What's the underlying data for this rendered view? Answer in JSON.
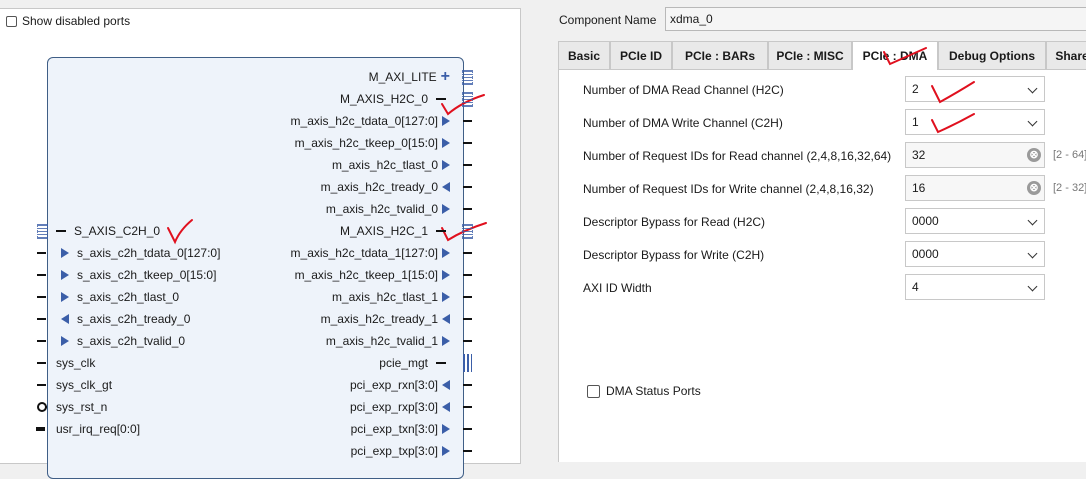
{
  "left": {
    "show_disabled_ports_label": "Show disabled ports",
    "right_pins": [
      {
        "label": "M_AXI_LITE",
        "kind": "plus"
      },
      {
        "label": "M_AXIS_H2C_0",
        "kind": "dash"
      },
      {
        "label": "m_axis_h2c_tdata_0[127:0]",
        "kind": "out"
      },
      {
        "label": "m_axis_h2c_tkeep_0[15:0]",
        "kind": "out"
      },
      {
        "label": "m_axis_h2c_tlast_0",
        "kind": "out"
      },
      {
        "label": "m_axis_h2c_tready_0",
        "kind": "in"
      },
      {
        "label": "m_axis_h2c_tvalid_0",
        "kind": "out"
      },
      {
        "label": "M_AXIS_H2C_1",
        "kind": "dash"
      },
      {
        "label": "m_axis_h2c_tdata_1[127:0]",
        "kind": "out"
      },
      {
        "label": "m_axis_h2c_tkeep_1[15:0]",
        "kind": "out"
      },
      {
        "label": "m_axis_h2c_tlast_1",
        "kind": "out"
      },
      {
        "label": "m_axis_h2c_tready_1",
        "kind": "in"
      },
      {
        "label": "m_axis_h2c_tvalid_1",
        "kind": "out"
      },
      {
        "label": "pcie_mgt",
        "kind": "dash"
      },
      {
        "label": "pci_exp_rxn[3:0]",
        "kind": "in"
      },
      {
        "label": "pci_exp_rxp[3:0]",
        "kind": "in"
      },
      {
        "label": "pci_exp_txn[3:0]",
        "kind": "out"
      },
      {
        "label": "pci_exp_txp[3:0]",
        "kind": "out"
      }
    ],
    "left_pins": [
      {
        "label": "S_AXIS_C2H_0",
        "kind": "bus"
      },
      {
        "label": "s_axis_c2h_tdata_0[127:0]",
        "kind": "in"
      },
      {
        "label": "s_axis_c2h_tkeep_0[15:0]",
        "kind": "in"
      },
      {
        "label": "s_axis_c2h_tlast_0",
        "kind": "in"
      },
      {
        "label": "s_axis_c2h_tready_0",
        "kind": "out"
      },
      {
        "label": "s_axis_c2h_tvalid_0",
        "kind": "in"
      },
      {
        "label": "sys_clk",
        "kind": "plain"
      },
      {
        "label": "sys_clk_gt",
        "kind": "plain"
      },
      {
        "label": "sys_rst_n",
        "kind": "bubble"
      },
      {
        "label": "usr_irq_req[0:0]",
        "kind": "bus-line"
      }
    ]
  },
  "right": {
    "component_name_label": "Component Name",
    "component_name_value": "xdma_0",
    "tabs": [
      {
        "label": "Basic",
        "active": false
      },
      {
        "label": "PCIe ID",
        "active": false
      },
      {
        "label": "PCIe : BARs",
        "active": false
      },
      {
        "label": "PCIe : MISC",
        "active": false
      },
      {
        "label": "PCIe : DMA",
        "active": true
      },
      {
        "label": "Debug Options",
        "active": false
      },
      {
        "label": "Share",
        "active": false
      }
    ],
    "fields": [
      {
        "label": "Number of DMA Read Channel (H2C)",
        "value": "2",
        "control": "select",
        "range": ""
      },
      {
        "label": "Number of DMA Write Channel (C2H)",
        "value": "1",
        "control": "select",
        "range": ""
      },
      {
        "label": "Number of Request IDs for Read channel (2,4,8,16,32,64)",
        "value": "32",
        "control": "input",
        "range": "[2 - 64]"
      },
      {
        "label": "Number of Request IDs for Write channel (2,4,8,16,32)",
        "value": "16",
        "control": "input",
        "range": "[2 - 32]"
      },
      {
        "label": "Descriptor Bypass for Read (H2C)",
        "value": "0000",
        "control": "select",
        "range": ""
      },
      {
        "label": "Descriptor Bypass for Write (C2H)",
        "value": "0000",
        "control": "select",
        "range": ""
      },
      {
        "label": "AXI ID Width",
        "value": "4",
        "control": "select",
        "range": ""
      }
    ],
    "dma_status_ports_label": "DMA Status Ports",
    "clear_glyph": "⊗"
  },
  "colors": {
    "accent": "#3b5ea8",
    "annotation": "#e0101e"
  }
}
